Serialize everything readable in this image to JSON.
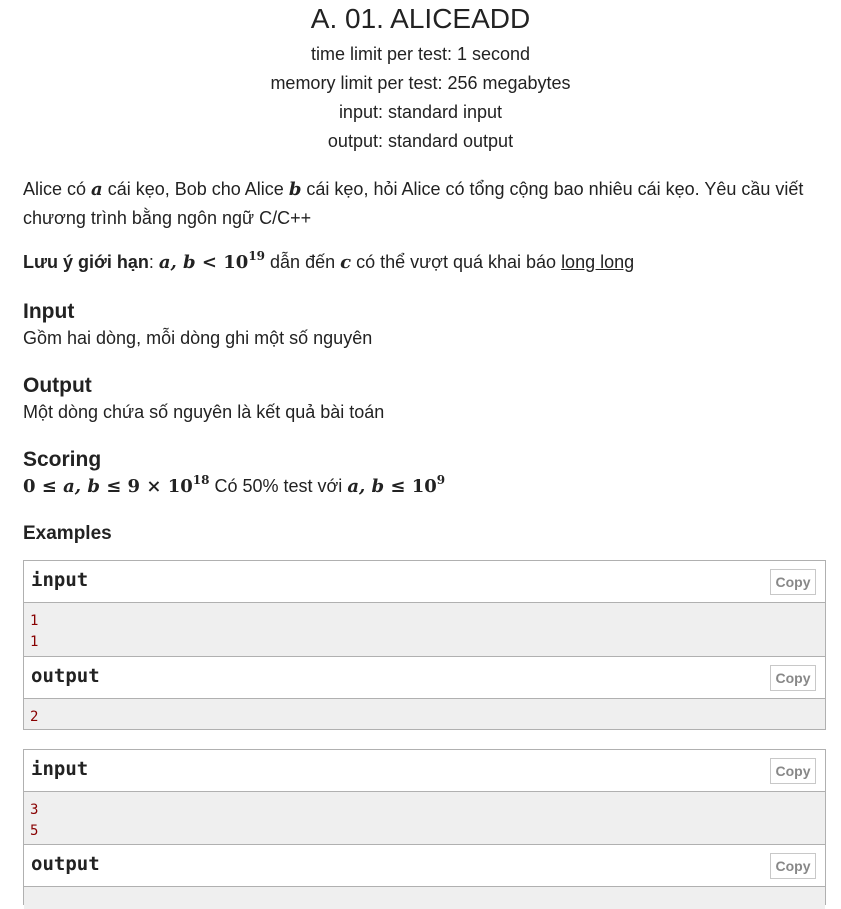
{
  "problem": {
    "title": "A. 01. ALICEADD",
    "time_limit": "time limit per test: 1 second",
    "memory_limit": "memory limit per test: 256 megabytes",
    "input": "input: standard input",
    "output": "output: standard output"
  },
  "statement": {
    "p1_part1": "Alice có ",
    "var_a": "a",
    "p1_part2": " cái kẹo, Bob cho Alice ",
    "var_b": "b",
    "p1_part3": " cái kẹo, hỏi Alice có tổng cộng bao nhiêu cái kẹo. Yêu cầu viết chương trình bằng ngôn ngữ C/C++",
    "note_label": "Lưu ý giới hạn",
    "note_colon": ": ",
    "note_math_vars": "a, b",
    "note_math_lt": " < 10",
    "note_math_exp": "19",
    "note_part1": " dẫn đến ",
    "var_c": "c",
    "note_part2": " có thể vượt quá khai báo ",
    "note_link": "long long"
  },
  "sections": {
    "input_title": "Input",
    "input_text": "Gồm hai dòng, mỗi dòng ghi một số nguyên",
    "output_title": "Output",
    "output_text": "Một dòng chứa số nguyên là kết quả bài toán",
    "scoring_title": "Scoring",
    "scoring_math_a": "0 ≤ ",
    "scoring_math_vars": "a, b",
    "scoring_math_b": " ≤ 9 × 10",
    "scoring_math_exp": "18",
    "scoring_text": " Có 50% test với ",
    "scoring_math2_vars": "a, b",
    "scoring_math2_b": " ≤ 10",
    "scoring_math2_exp": "9"
  },
  "examples": {
    "title": "Examples",
    "copy_label": "Copy",
    "input_label": "input",
    "output_label": "output",
    "ex1_input_line1": "1",
    "ex1_input_line2": "1",
    "ex1_output_line1": "2",
    "ex2_input_line1": "3",
    "ex2_input_line2": "5"
  }
}
